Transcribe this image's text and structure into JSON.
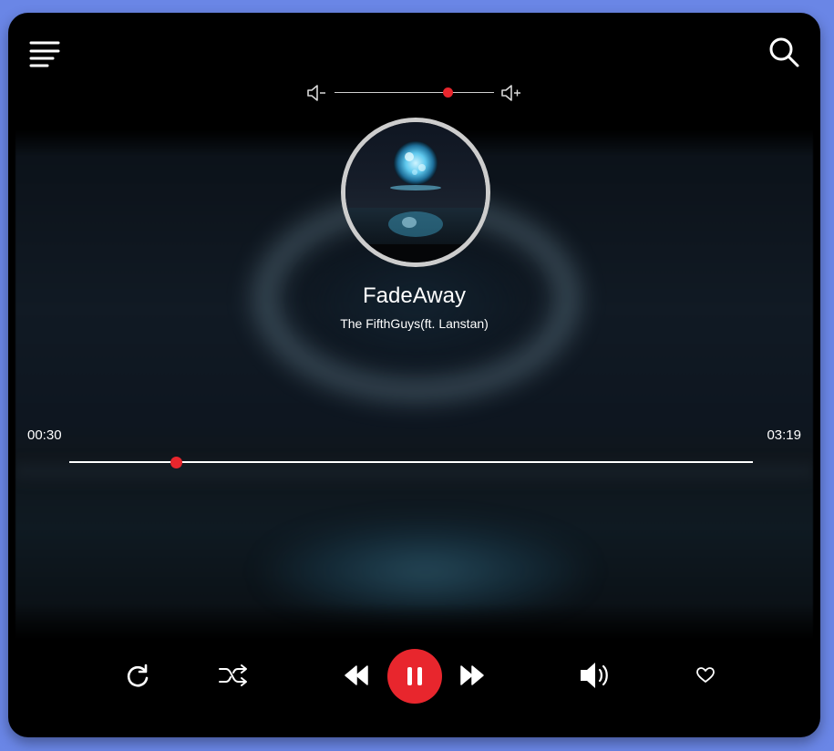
{
  "colors": {
    "page_background": "#6a86e6",
    "player_background": "#000000",
    "accent": "#e8262d",
    "text": "#ffffff",
    "album_border": "#cdcdcd"
  },
  "header": {
    "menu_icon": "hamburger-menu-icon",
    "search_icon": "search-icon"
  },
  "volume": {
    "decrease_icon": "volume-down-icon",
    "increase_icon": "volume-up-icon",
    "level": 0.71
  },
  "track": {
    "title": "FadeAway",
    "artist": "The FifthGuys(ft. Lanstan)"
  },
  "progress": {
    "current_time": "00:30",
    "total_time": "03:19",
    "fraction": 0.156
  },
  "controls": {
    "repeat_icon": "repeat-icon",
    "shuffle_icon": "shuffle-icon",
    "previous_icon": "rewind-icon",
    "play_pause_icon": "pause-icon",
    "next_icon": "fast-forward-icon",
    "volume_icon": "speaker-icon",
    "favorite_icon": "heart-icon"
  }
}
